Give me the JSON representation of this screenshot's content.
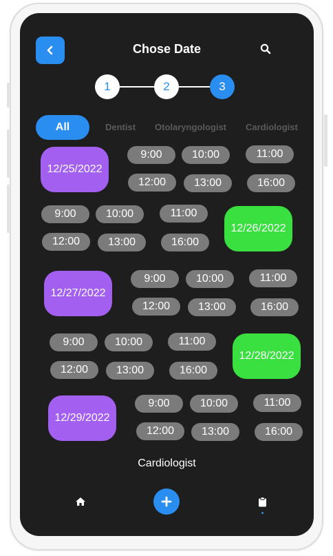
{
  "header": {
    "title": "Chose Date"
  },
  "stepper": {
    "steps": [
      "1",
      "2",
      "3"
    ],
    "active_step": 3
  },
  "tabs": [
    "All",
    "Dentist",
    "Otolaryngologist",
    "Cardiologist"
  ],
  "schedule": [
    {
      "date": "12/25/2022",
      "color": "#a35ff0",
      "times": [
        "9:00",
        "10:00",
        "11:00",
        "12:00",
        "13:00",
        "16:00"
      ]
    },
    {
      "date": "12/26/2022",
      "color": "#3ae040",
      "times": [
        "9:00",
        "10:00",
        "11:00",
        "12:00",
        "13:00",
        "16:00"
      ]
    },
    {
      "date": "12/27/2022",
      "color": "#a35ff0",
      "times": [
        "9:00",
        "10:00",
        "11:00",
        "12:00",
        "13:00",
        "16:00"
      ]
    },
    {
      "date": "12/28/2022",
      "color": "#3ae040",
      "times": [
        "9:00",
        "10:00",
        "11:00",
        "12:00",
        "13:00",
        "16:00"
      ]
    },
    {
      "date": "12/29/2022",
      "color": "#a35ff0",
      "times": [
        "9:00",
        "10:00",
        "11:00",
        "12:00",
        "13:00",
        "16:00"
      ]
    }
  ],
  "footer": {
    "label": "Cardiologist"
  },
  "bottom_nav": {
    "icons": [
      "home-icon",
      "plus-icon",
      "clipboard-icon"
    ]
  },
  "colors": {
    "accent": "#2a8df0",
    "background": "#1e1e1e",
    "time_chip": "#7b7b7b"
  }
}
